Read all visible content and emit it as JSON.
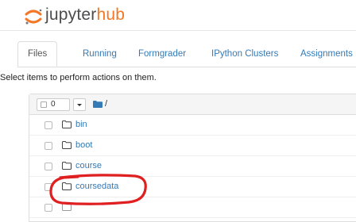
{
  "header": {
    "logo_jupyter": "jupyter",
    "logo_hub": "hub"
  },
  "tabs": [
    {
      "label": "Files",
      "active": true
    },
    {
      "label": "Running",
      "active": false
    },
    {
      "label": "Formgrader",
      "active": false
    },
    {
      "label": "IPython Clusters",
      "active": false
    },
    {
      "label": "Assignments",
      "active": false
    }
  ],
  "instructions": "Select items to perform actions on them.",
  "file_list": {
    "selected_count": "0",
    "path": "/",
    "items": [
      {
        "name": "bin",
        "icon": "folder-icon"
      },
      {
        "name": "boot",
        "icon": "folder-icon"
      },
      {
        "name": "course",
        "icon": "folder-icon"
      },
      {
        "name": "coursedata",
        "icon": "folder-icon",
        "highlighted": true
      }
    ]
  },
  "colors": {
    "brand_orange": "#f37726",
    "link_blue": "#337ab7",
    "annotation_red": "#e02020"
  }
}
